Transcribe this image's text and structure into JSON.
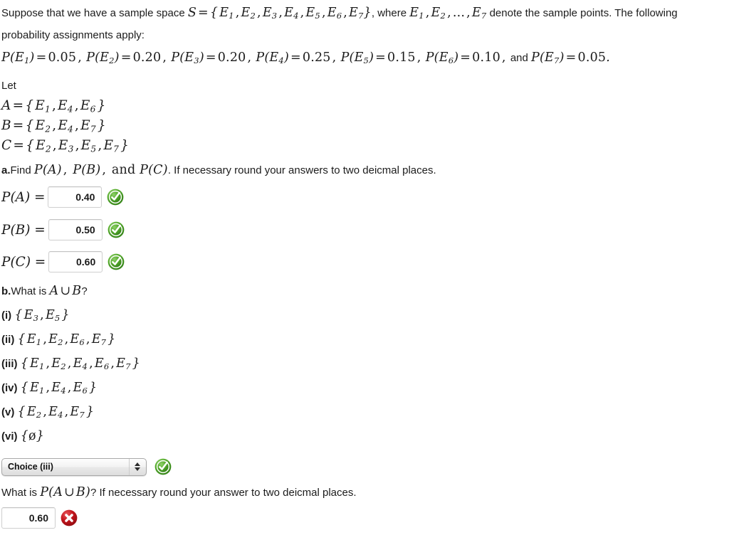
{
  "problem": {
    "intro_1": "Suppose that we have a sample space ",
    "intro_S": "S = {E1, E2, E3, E4, E5, E6, E7}",
    "intro_2": ", where ",
    "intro_E": "E1, E2, ..., E7",
    "intro_3": " denote the sample points. The following probability assignments apply:",
    "assignments_text": "P(E1) = 0.05, P(E2) = 0.20, P(E3) = 0.20, P(E4) = 0.25, P(E5) = 0.15, P(E6) = 0.10, and P(E7) = 0.05.",
    "let_label": "Let",
    "sets": [
      {
        "name": "A",
        "members": "{E1, E4, E6}"
      },
      {
        "name": "B",
        "members": "{E2, E4, E7}"
      },
      {
        "name": "C",
        "members": "{E2, E3, E5, E7}"
      }
    ]
  },
  "part_a": {
    "marker": "a.",
    "prompt_pre": "Find ",
    "prompt_math": "P(A), P(B), and P(C)",
    "prompt_post": ". If necessary round your answers to two deicmal places.",
    "answers": [
      {
        "label": "P(A) =",
        "value": "0.40",
        "status": "correct"
      },
      {
        "label": "P(B) =",
        "value": "0.50",
        "status": "correct"
      },
      {
        "label": "P(C) =",
        "value": "0.60",
        "status": "correct"
      }
    ]
  },
  "part_b": {
    "marker": "b.",
    "prompt_pre": "What is ",
    "prompt_math": "A ∪ B",
    "prompt_post": "?",
    "options": [
      {
        "key": "(i)",
        "set": "{E3, E5}"
      },
      {
        "key": "(ii)",
        "set": "{E1, E2, E6, E7}"
      },
      {
        "key": "(iii)",
        "set": "{E1, E2, E4, E6, E7}"
      },
      {
        "key": "(iv)",
        "set": "{E1, E4, E6}"
      },
      {
        "key": "(v)",
        "set": "{E2, E4, E7}"
      },
      {
        "key": "(vi)",
        "set": "{ø}"
      }
    ],
    "select_value": "Choice (iii)",
    "select_status": "correct",
    "followup_pre": "What is ",
    "followup_math": "P(A ∪ B)",
    "followup_post": "? If necessary round your answer to two deicmal places.",
    "followup_answer": {
      "value": "0.60",
      "status": "incorrect"
    }
  },
  "icons": {
    "correct": "green-check-icon",
    "incorrect": "red-x-icon",
    "select_arrows": "updown-arrows-icon"
  },
  "colors": {
    "correct_green": "#3f9a23",
    "correct_green_dark": "#2f7a18",
    "incorrect_red": "#c01118",
    "incorrect_red_dark": "#8e0b10",
    "text": "#1c1c1c",
    "input_border": "#cfcfcf"
  }
}
